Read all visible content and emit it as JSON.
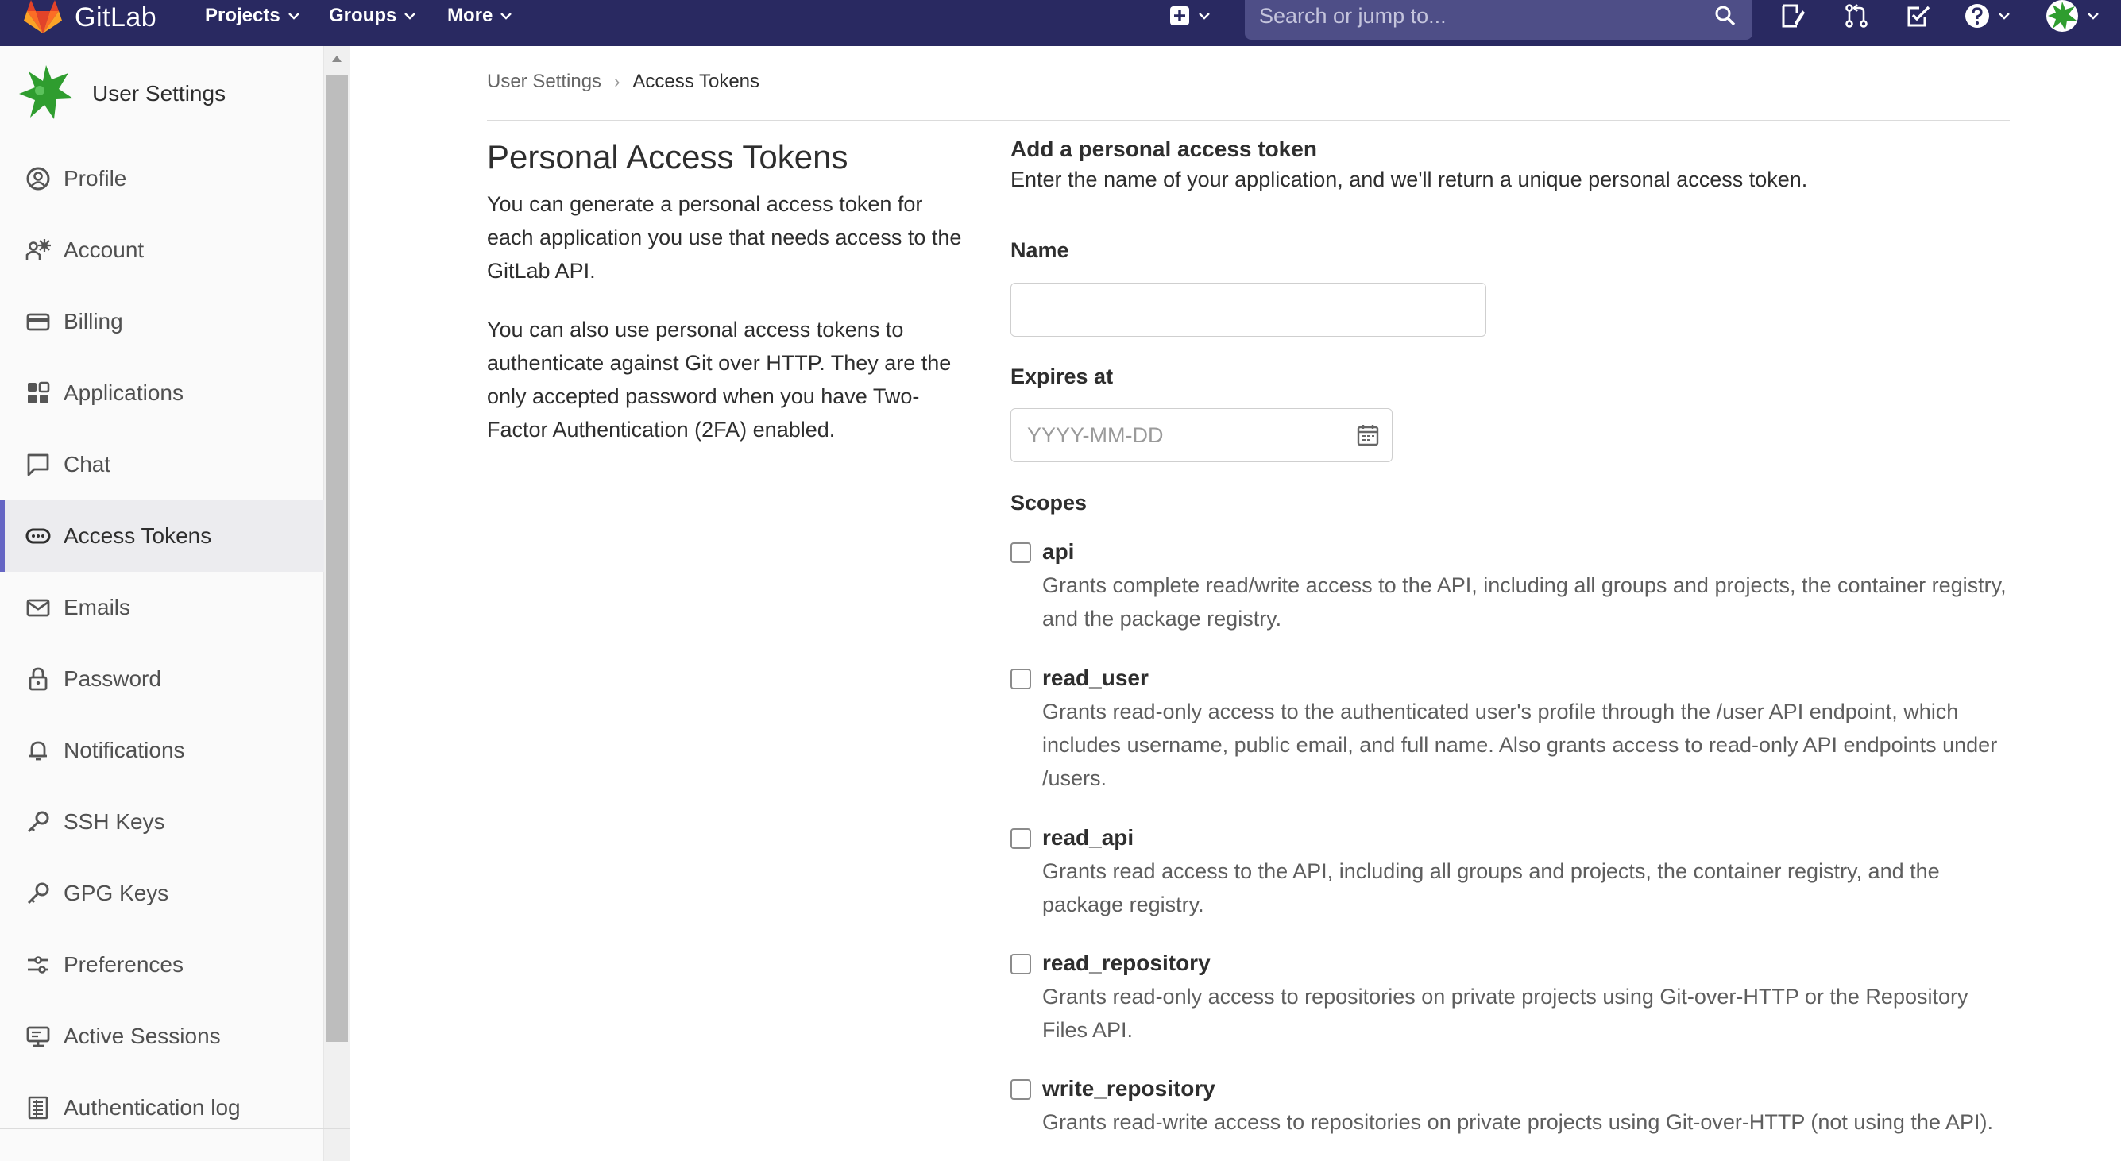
{
  "navbar": {
    "brand": "GitLab",
    "menus": [
      "Projects",
      "Groups",
      "More"
    ],
    "search_placeholder": "Search or jump to..."
  },
  "sidebar": {
    "title": "User Settings",
    "items": [
      {
        "label": "Profile",
        "icon": "profile-icon"
      },
      {
        "label": "Account",
        "icon": "account-icon"
      },
      {
        "label": "Billing",
        "icon": "credit-card-icon"
      },
      {
        "label": "Applications",
        "icon": "applications-icon"
      },
      {
        "label": "Chat",
        "icon": "comment-icon"
      },
      {
        "label": "Access Tokens",
        "icon": "token-icon",
        "active": true
      },
      {
        "label": "Emails",
        "icon": "mail-icon"
      },
      {
        "label": "Password",
        "icon": "lock-icon"
      },
      {
        "label": "Notifications",
        "icon": "bell-icon"
      },
      {
        "label": "SSH Keys",
        "icon": "key-icon"
      },
      {
        "label": "GPG Keys",
        "icon": "key-icon"
      },
      {
        "label": "Preferences",
        "icon": "preferences-icon"
      },
      {
        "label": "Active Sessions",
        "icon": "monitor-icon"
      },
      {
        "label": "Authentication log",
        "icon": "log-icon"
      }
    ]
  },
  "breadcrumb": {
    "parent": "User Settings",
    "current": "Access Tokens"
  },
  "intro": {
    "title": "Personal Access Tokens",
    "p1": "You can generate a personal access token for each application you use that needs access to the GitLab API.",
    "p2": "You can also use personal access tokens to authenticate against Git over HTTP. They are the only accepted password when you have Two-Factor Authentication (2FA) enabled."
  },
  "form": {
    "heading": "Add a personal access token",
    "description": "Enter the name of your application, and we'll return a unique personal access token.",
    "name_label": "Name",
    "name_value": "",
    "expires_label": "Expires at",
    "expires_placeholder": "YYYY-MM-DD",
    "scopes_label": "Scopes",
    "scopes": [
      {
        "name": "api",
        "description": "Grants complete read/write access to the API, including all groups and projects, the container registry, and the package registry.",
        "checked": false
      },
      {
        "name": "read_user",
        "description": "Grants read-only access to the authenticated user's profile through the /user API endpoint, which includes username, public email, and full name. Also grants access to read-only API endpoints under /users.",
        "checked": false
      },
      {
        "name": "read_api",
        "description": "Grants read access to the API, including all groups and projects, the container registry, and the package registry.",
        "checked": false
      },
      {
        "name": "read_repository",
        "description": "Grants read-only access to repositories on private projects using Git-over-HTTP or the Repository Files API.",
        "checked": false
      },
      {
        "name": "write_repository",
        "description": "Grants read-write access to repositories on private projects using Git-over-HTTP (not using the API).",
        "checked": false
      }
    ]
  },
  "colors": {
    "navbar": "#292961",
    "search": "#4e4e87",
    "active_accent": "#6666c4",
    "gitlab_orange": "#fc6d26"
  }
}
